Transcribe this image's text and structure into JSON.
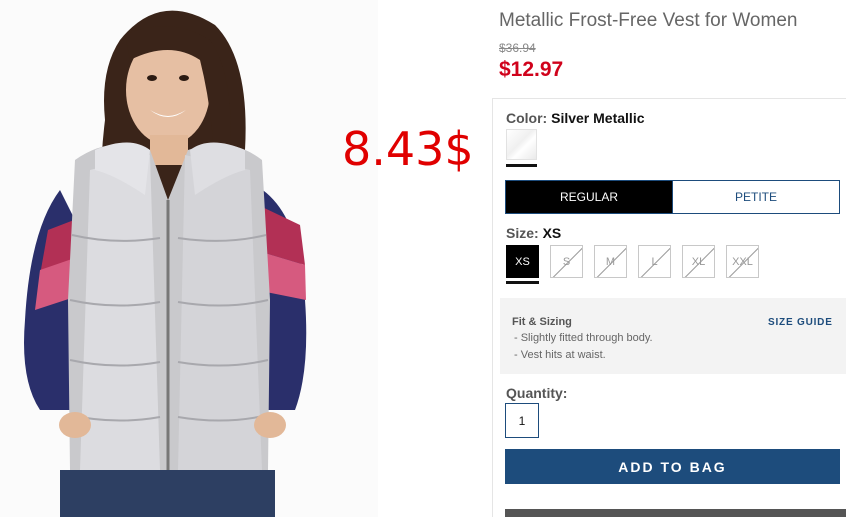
{
  "product": {
    "title": "Metallic Frost-Free Vest for Women",
    "original_price": "$36.94",
    "sale_price": "$12.97"
  },
  "annotation": {
    "overlay_price": "8.43$"
  },
  "color": {
    "label": "Color:",
    "value": "Silver Metallic"
  },
  "fit_options": [
    {
      "label": "REGULAR",
      "selected": true
    },
    {
      "label": "PETITE",
      "selected": false
    }
  ],
  "size": {
    "label": "Size:",
    "value": "XS",
    "options": [
      {
        "label": "XS",
        "selected": true,
        "available": true
      },
      {
        "label": "S",
        "selected": false,
        "available": false
      },
      {
        "label": "M",
        "selected": false,
        "available": false
      },
      {
        "label": "L",
        "selected": false,
        "available": false
      },
      {
        "label": "XL",
        "selected": false,
        "available": false
      },
      {
        "label": "XXL",
        "selected": false,
        "available": false
      }
    ]
  },
  "fit_sizing": {
    "title": "Fit & Sizing",
    "size_guide_label": "SIZE GUIDE",
    "lines": [
      "- Slightly fitted through body.",
      "- Vest hits at waist."
    ]
  },
  "quantity": {
    "label": "Quantity:",
    "value": "1"
  },
  "add_to_bag_label": "ADD TO BAG",
  "colors": {
    "sale_red": "#d0021b",
    "overlay_red": "#e00000",
    "navy": "#1d4c7c"
  }
}
